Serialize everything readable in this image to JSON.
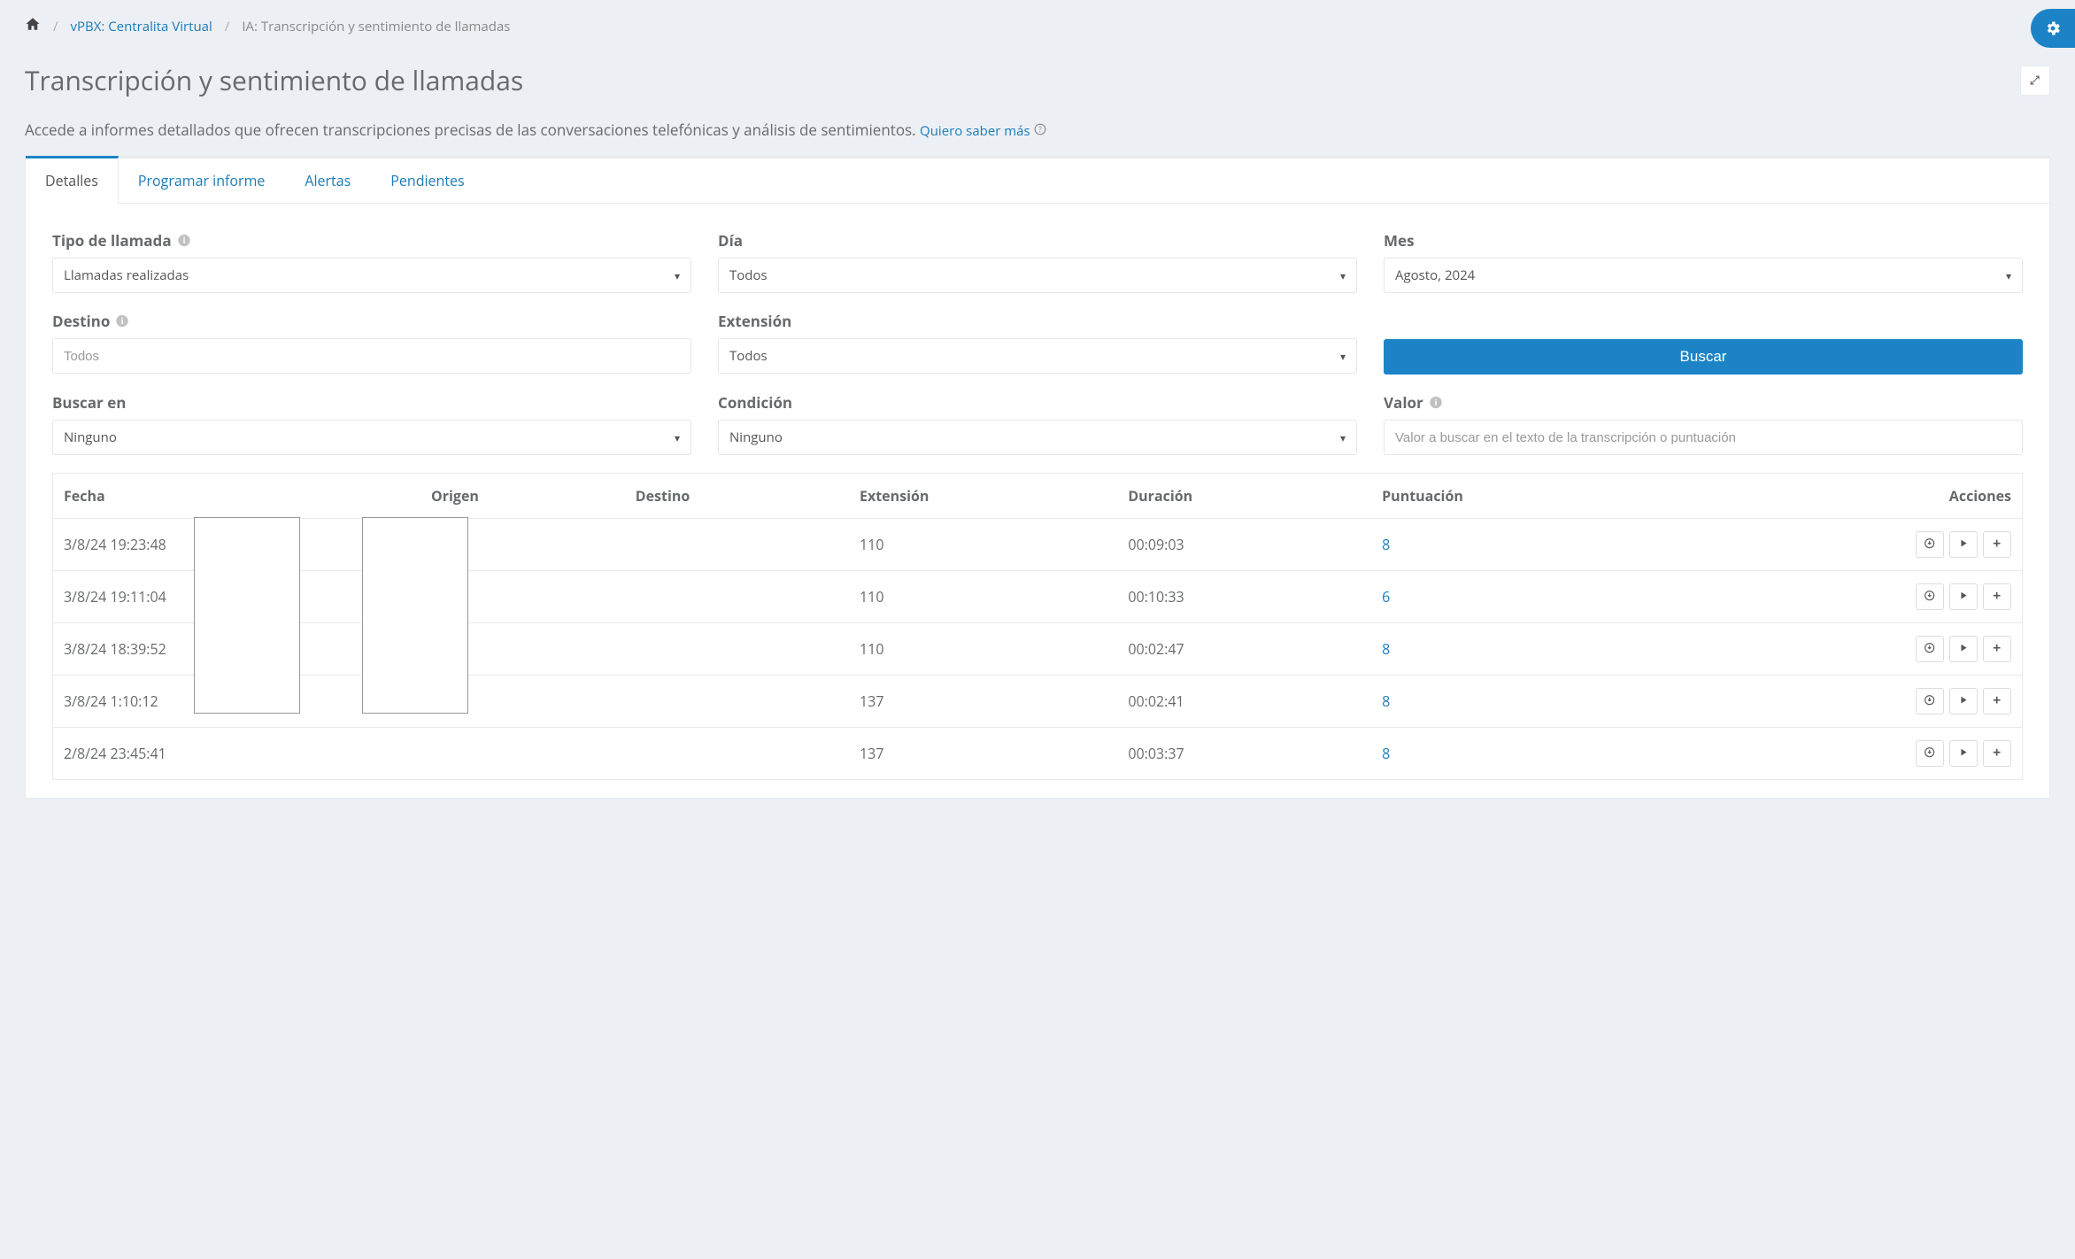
{
  "breadcrumb": {
    "home": "Home",
    "level1": "vPBX: Centralita Virtual",
    "current": "IA: Transcripción y sentimiento de llamadas"
  },
  "page": {
    "title": "Transcripción y sentimiento de llamadas",
    "description": "Accede a informes detallados que ofrecen transcripciones precisas de las conversaciones telefónicas y análisis de sentimientos.",
    "more_link": "Quiero saber más"
  },
  "tabs": [
    {
      "id": "detalles",
      "label": "Detalles",
      "active": true
    },
    {
      "id": "programar",
      "label": "Programar informe",
      "active": false
    },
    {
      "id": "alertas",
      "label": "Alertas",
      "active": false
    },
    {
      "id": "pendientes",
      "label": "Pendientes",
      "active": false
    }
  ],
  "filters": {
    "tipo_llamada": {
      "label": "Tipo de llamada",
      "value": "Llamadas realizadas"
    },
    "dia": {
      "label": "Día",
      "value": "Todos"
    },
    "mes": {
      "label": "Mes",
      "value": "Agosto, 2024"
    },
    "destino": {
      "label": "Destino",
      "placeholder": "Todos"
    },
    "extension": {
      "label": "Extensión",
      "value": "Todos"
    },
    "buscar": {
      "label": "Buscar"
    },
    "buscar_en": {
      "label": "Buscar en",
      "value": "Ninguno"
    },
    "condicion": {
      "label": "Condición",
      "value": "Ninguno"
    },
    "valor": {
      "label": "Valor",
      "placeholder": "Valor a buscar en el texto de la transcripción o puntuación"
    }
  },
  "table": {
    "headers": {
      "fecha": "Fecha",
      "origen": "Origen",
      "destino": "Destino",
      "extension": "Extensión",
      "duracion": "Duración",
      "puntuacion": "Puntuación",
      "acciones": "Acciones"
    },
    "rows": [
      {
        "fecha": "3/8/24 19:23:48",
        "origen": "",
        "destino": "",
        "extension": "110",
        "duracion": "00:09:03",
        "puntuacion": "8"
      },
      {
        "fecha": "3/8/24 19:11:04",
        "origen": "",
        "destino": "",
        "extension": "110",
        "duracion": "00:10:33",
        "puntuacion": "6"
      },
      {
        "fecha": "3/8/24 18:39:52",
        "origen": "",
        "destino": "",
        "extension": "110",
        "duracion": "00:02:47",
        "puntuacion": "8"
      },
      {
        "fecha": "3/8/24 1:10:12",
        "origen": "",
        "destino": "",
        "extension": "137",
        "duracion": "00:02:41",
        "puntuacion": "8"
      },
      {
        "fecha": "2/8/24 23:45:41",
        "origen": "",
        "destino": "",
        "extension": "137",
        "duracion": "00:03:37",
        "puntuacion": "8"
      }
    ]
  }
}
